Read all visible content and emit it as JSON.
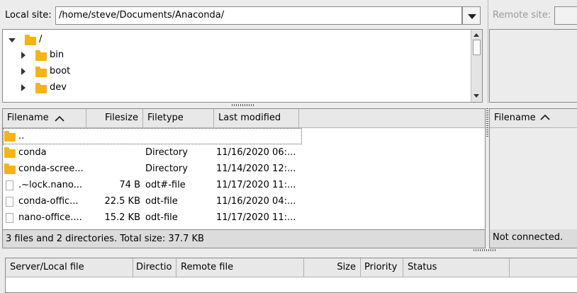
{
  "local_site": {
    "label": "Local site:",
    "path": "/home/steve/Documents/Anaconda/"
  },
  "remote_site": {
    "label": "Remote site:"
  },
  "local_tree": {
    "root": "/",
    "children": [
      "bin",
      "boot",
      "dev"
    ]
  },
  "local_list": {
    "columns": [
      "Filename",
      "Filesize",
      "Filetype",
      "Last modified"
    ],
    "rows": [
      {
        "name": "..",
        "size": "",
        "type": "",
        "modified": ""
      },
      {
        "name": "conda",
        "size": "",
        "type": "Directory",
        "modified": "11/16/2020 06:..."
      },
      {
        "name": "conda-scree...",
        "size": "",
        "type": "Directory",
        "modified": "11/14/2020 12:..."
      },
      {
        "name": ".~lock.nano...",
        "size": "74 B",
        "type": "odt#-file",
        "modified": "11/17/2020 11:..."
      },
      {
        "name": "conda-offic...",
        "size": "22.5 KB",
        "type": "odt-file",
        "modified": "11/16/2020 04:..."
      },
      {
        "name": "nano-office....",
        "size": "15.2 KB",
        "type": "odt-file",
        "modified": "11/17/2020 11:..."
      }
    ],
    "status": "3 files and 2 directories. Total size: 37.7 KB"
  },
  "remote_list": {
    "columns": [
      "Filename"
    ],
    "status": "Not connected."
  },
  "queue": {
    "columns": [
      "Server/Local file",
      "Directio",
      "Remote file",
      "Size",
      "Priority",
      "Status"
    ]
  }
}
